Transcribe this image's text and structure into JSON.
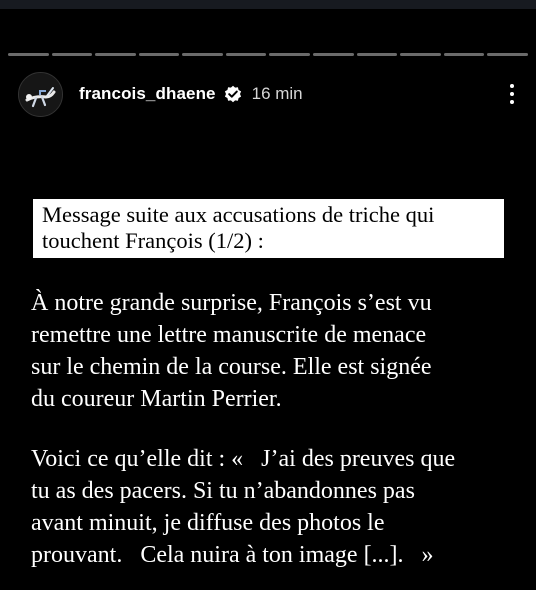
{
  "story": {
    "segments": 12,
    "current_segment": 1,
    "current_progress": 0.0
  },
  "header": {
    "username": "francois_dhaene",
    "verified": true,
    "time": "16 min"
  },
  "content": {
    "title_lines": [
      "Message suite aux accusations de triche qui",
      "touchent François (1/2) :"
    ],
    "paragraph1_lines": [
      "À notre grande surprise, François s’est vu",
      "remettre une lettre manuscrite de menace",
      "sur le chemin de la course. Elle est signée",
      "du coureur Martin Perrier."
    ],
    "paragraph2_lines": [
      "Voici ce qu’elle dit : «   J’ai des preuves que",
      "tu as des pacers. Si tu n’abandonnes pas",
      "avant minuit, je diffuse des photos le",
      "prouvant.   Cela nuira à ton image [...].   »"
    ]
  },
  "colors": {
    "background": "#000000",
    "text": "#ffffff",
    "title_box": "#ffffff",
    "title_text": "#000000"
  },
  "icons": {
    "verified": "verified-badge-icon",
    "more": "more-vertical-icon"
  }
}
